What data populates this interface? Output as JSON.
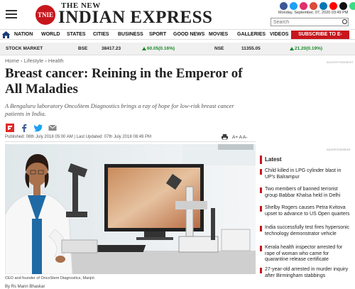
{
  "header": {
    "logo_mark": "TNIE",
    "logo_top": "THE NEW",
    "logo_main": "INDIAN EXPRESS",
    "dateline": "Monday, September, 07, 2020 03:49 PM",
    "search_placeholder": "Search"
  },
  "nav": {
    "items": [
      "NATION",
      "WORLD",
      "STATES",
      "CITIES",
      "BUSINESS",
      "SPORT",
      "GOOD NEWS",
      "MOVIES",
      "GALLERIES",
      "VIDEOS"
    ],
    "subscribe_label": "SUBSCRIBE TO E-PAPER"
  },
  "ticker": {
    "label": "STOCK MARKET",
    "bse_label": "BSE",
    "bse_value": "38417.23",
    "bse_change": "60.05(0.16%)",
    "nse_label": "NSE",
    "nse_value": "11355.05",
    "nse_change": "21.20(0.19%)"
  },
  "breadcrumb": {
    "home": "Home",
    "sep": "›",
    "section": "Lifestyle",
    "subsection": "Health"
  },
  "advertisement_label": "ADVERTISEMENT",
  "article": {
    "title": "Breast cancer: Reining in the Emperor of All Maladies",
    "summary": "A Bengaluru laboratory OncoStem Diagnostics brings a ray of hope for low-risk breast cancer patients in India.",
    "published": "Published: 08th July 2018 05:00 AM",
    "separator": "|",
    "updated": "Last Updated: 07th July 2018 08:49 PM",
    "font_tools": "A+ A A-",
    "caption": "CEO and founder of OncoStem Diagnostics, Manjiri.",
    "byline": "By Rs Mann Bhaskar"
  },
  "sidebar": {
    "heading": "Latest",
    "items": [
      "Child killed in LPG cylinder blast in UP's Balrampur",
      "Two members of banned terrorist group Babbar Khalsa held in Delhi",
      "Shelby Rogers causes Petra Kvitova upset to advance to US Open quarters",
      "India successfully test fires hypersonic technology demonstrator vehicle",
      "Kerala health inspector arrested for rape of woman who came for quarantine release certificate",
      "27-year-old arrested in murder inquiry after Birmingham stabbings"
    ]
  },
  "colors": {
    "brand_red": "#c8161d",
    "stock_up": "#1a8a2a"
  }
}
